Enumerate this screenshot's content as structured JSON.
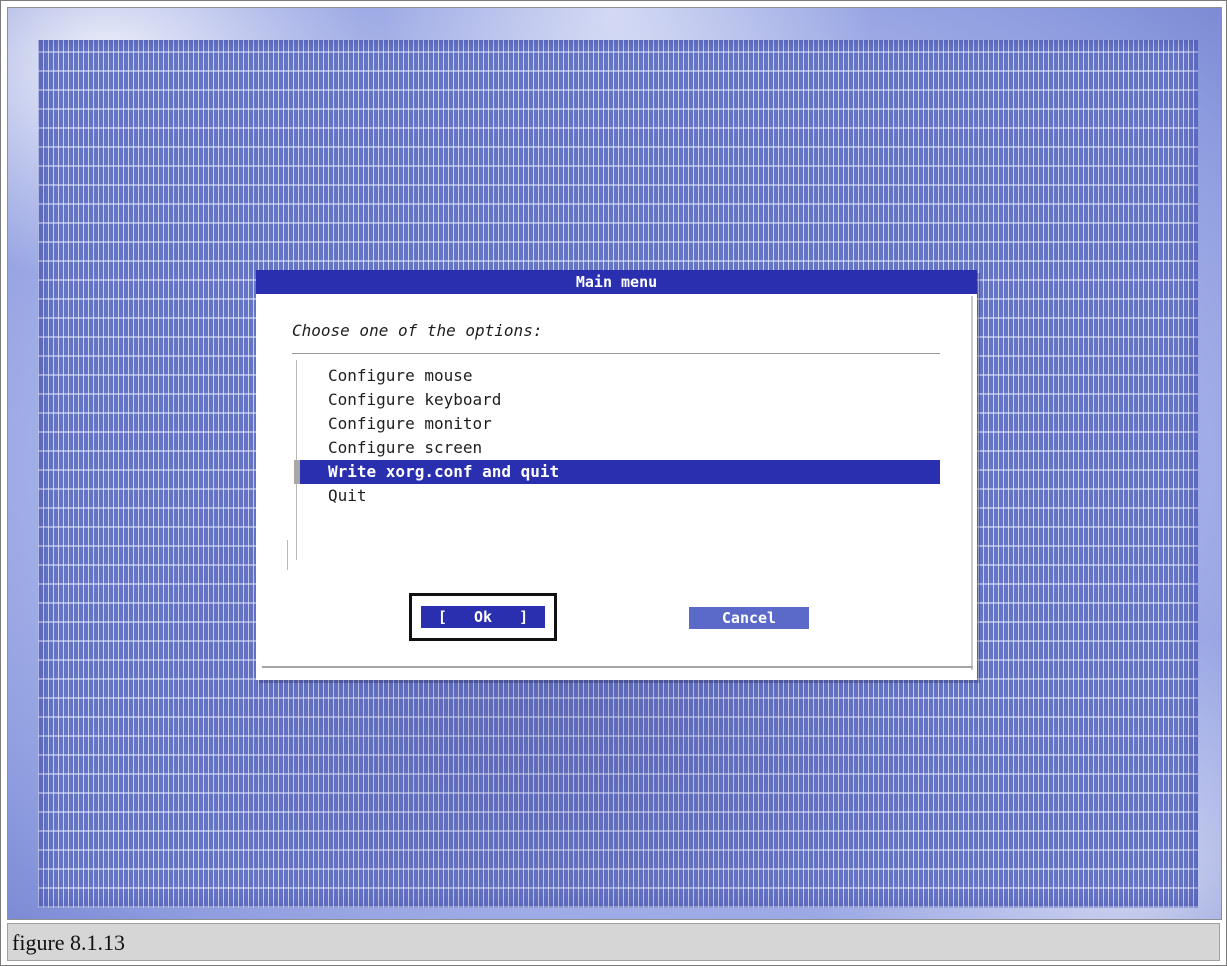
{
  "dialog": {
    "title": "Main menu",
    "prompt": "Choose one of the options:",
    "options": [
      "Configure mouse",
      "Configure keyboard",
      "Configure monitor",
      "Configure screen",
      "Write xorg.conf and quit",
      "Quit"
    ],
    "selected_option": "Write xorg.conf and quit",
    "ok_label": "[   Ok   ]",
    "cancel_label": "Cancel"
  },
  "caption": "figure 8.1.13",
  "colors": {
    "dialog_title_bg": "#2a2fb0",
    "selection_bg": "#2a2fb0",
    "cancel_bg": "#5b6ac8",
    "console_bg": "#6674c6"
  }
}
